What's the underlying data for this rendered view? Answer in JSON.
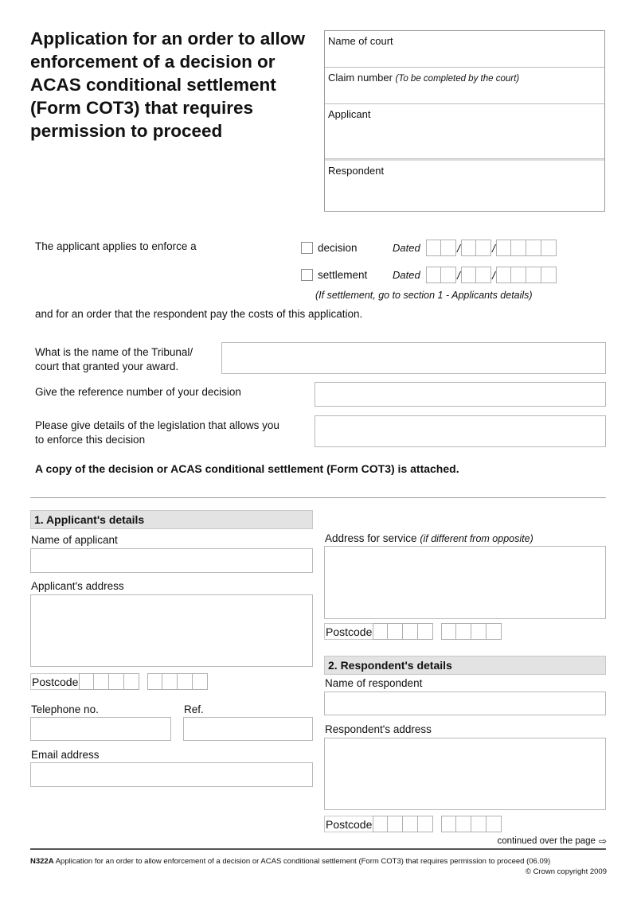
{
  "title": "Application for an order to allow enforcement of a decision or ACAS conditional settlement (Form COT3) that requires permission to proceed",
  "court_box": {
    "name_of_court": "Name of court",
    "claim_number": "Claim number",
    "claim_number_note": "(To be completed by the court)",
    "applicant": "Applicant",
    "respondent": "Respondent"
  },
  "applies": {
    "intro": "The applicant applies to enforce a",
    "options": [
      {
        "label": "decision",
        "dated_label": "Dated",
        "checked": false
      },
      {
        "label": "settlement",
        "dated_label": "Dated",
        "checked": false
      }
    ],
    "date_separator": "/",
    "settlement_note": "(If settlement, go to section 1 - Applicants details)",
    "costs_text": "and for an order that the respondent pay the costs of this application."
  },
  "questions": {
    "tribunal_name": "What is the name of the Tribunal/ court that granted your award.",
    "reference_number": "Give the reference number of your decision",
    "legislation": "Please give details of the legislation that allows you to enforce this decision",
    "attached_statement": "A copy of the decision or ACAS conditional settlement (Form COT3) is attached."
  },
  "section1": {
    "heading": "1. Applicant's details",
    "name_label": "Name of applicant",
    "address_label": "Applicant's address",
    "postcode_label": "Postcode",
    "telephone_label": "Telephone no.",
    "ref_label": "Ref.",
    "email_label": "Email address"
  },
  "service": {
    "label": "Address for service",
    "note": "(if different from opposite)",
    "postcode_label": "Postcode"
  },
  "section2": {
    "heading": "2. Respondent's details",
    "name_label": "Name of respondent",
    "address_label": "Respondent's address",
    "postcode_label": "Postcode"
  },
  "footer": {
    "continued": "continued over the page",
    "continued_icon": "arrow-right-icon",
    "form_code": "N322A",
    "form_description": "Application for an order to allow enforcement of a decision or ACAS conditional settlement (Form COT3) that requires permission to proceed (06.09)",
    "copyright": "© Crown copyright 2009"
  }
}
